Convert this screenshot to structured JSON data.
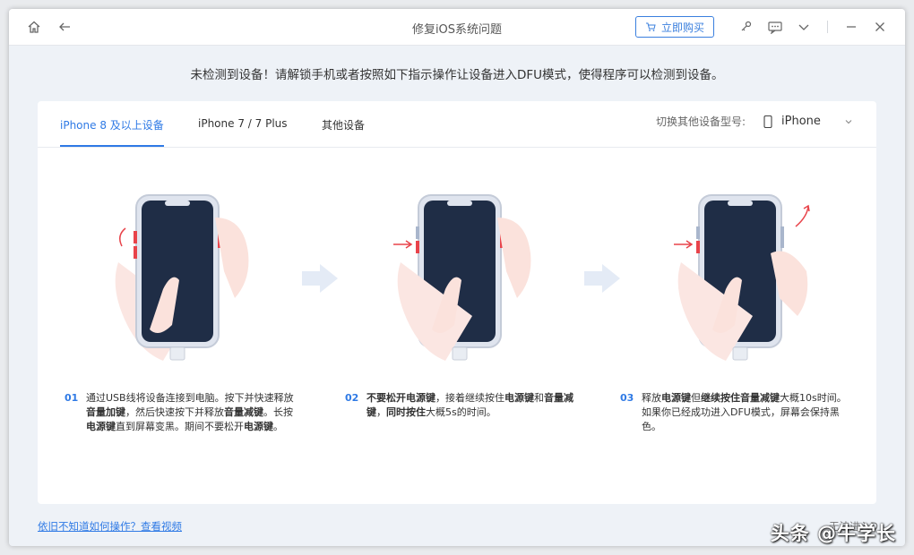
{
  "window": {
    "title": "修复iOS系统问题",
    "buy_label": "立即购买",
    "icons": [
      "home-icon",
      "back-arrow-icon",
      "cart-icon",
      "key-icon",
      "feedback-icon",
      "chevron-down-icon",
      "minimize-icon",
      "close-icon"
    ]
  },
  "notice": "未检测到设备！请解锁手机或者按照如下指示操作让设备进入DFU模式，使得程序可以检测到设备。",
  "tabs": [
    {
      "label": "iPhone 8 及以上设备",
      "active": true
    },
    {
      "label": "iPhone 7 / 7 Plus",
      "active": false
    },
    {
      "label": "其他设备",
      "active": false
    }
  ],
  "device_switch": {
    "label": "切换其他设备型号:",
    "value": "iPhone"
  },
  "steps": [
    {
      "num": "01",
      "parts": [
        {
          "t": "通过USB线将设备连接到电脑。按下并快速释放",
          "b": false
        },
        {
          "t": "音量加键",
          "b": true
        },
        {
          "t": "，然后快速按下并释放",
          "b": false
        },
        {
          "t": "音量减键",
          "b": true
        },
        {
          "t": "。长按",
          "b": false
        },
        {
          "t": "电源键",
          "b": true
        },
        {
          "t": "直到屏幕变黑。期间不要松开",
          "b": false
        },
        {
          "t": "电源键",
          "b": true
        },
        {
          "t": "。",
          "b": false
        }
      ]
    },
    {
      "num": "02",
      "parts": [
        {
          "t": "不要松开电源键",
          "b": true
        },
        {
          "t": "，接着继续按住",
          "b": false
        },
        {
          "t": "电源键",
          "b": true
        },
        {
          "t": "和",
          "b": false
        },
        {
          "t": "音量减键",
          "b": true
        },
        {
          "t": "，",
          "b": false
        },
        {
          "t": "同时按住",
          "b": true
        },
        {
          "t": "大概5s的时间。",
          "b": false
        }
      ]
    },
    {
      "num": "03",
      "parts": [
        {
          "t": "释放",
          "b": false
        },
        {
          "t": "电源键",
          "b": true
        },
        {
          "t": "但",
          "b": false
        },
        {
          "t": "继续按住音量减键",
          "b": true
        },
        {
          "t": "大概10s时间。 如果你已经成功进入DFU模式，屏幕会保持黑色。",
          "b": false
        }
      ]
    }
  ],
  "footer": {
    "help_link": "依旧不知道如何操作？查看视频",
    "right_text": "无法进入D",
    "watermark": "头条 @牛学长"
  },
  "colors": {
    "accent": "#2f7ae5",
    "phone_screen": "#1f2d46",
    "button_highlight": "#e8434a"
  }
}
